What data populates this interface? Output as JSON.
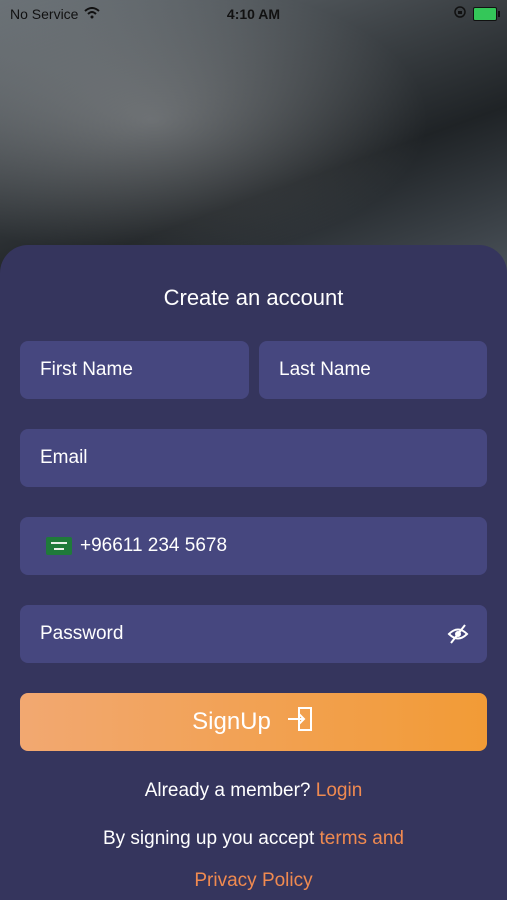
{
  "status_bar": {
    "carrier": "No Service",
    "time": "4:10 AM"
  },
  "form": {
    "title": "Create an account",
    "first_name_placeholder": "First Name",
    "last_name_placeholder": "Last Name",
    "email_placeholder": "Email",
    "phone_value": "+96611 234 5678",
    "password_placeholder": "Password",
    "signup_label": "SignUp"
  },
  "footer": {
    "member_text": "Already a member?",
    "login_link": "Login",
    "terms_text": "By signing up you accept",
    "terms_link": "terms and",
    "privacy_link": "Privacy Policy"
  },
  "colors": {
    "card_background": "#35355d",
    "field_background": "#46477f",
    "accent": "#f08a50",
    "signup_gradient_start": "#f2a871",
    "signup_gradient_end": "#f29b36"
  },
  "icons": {
    "wifi": "wifi-icon",
    "battery": "battery-icon",
    "flag": "saudi-flag-icon",
    "password_toggle": "eye-off-icon",
    "signup": "login-arrow-icon"
  }
}
